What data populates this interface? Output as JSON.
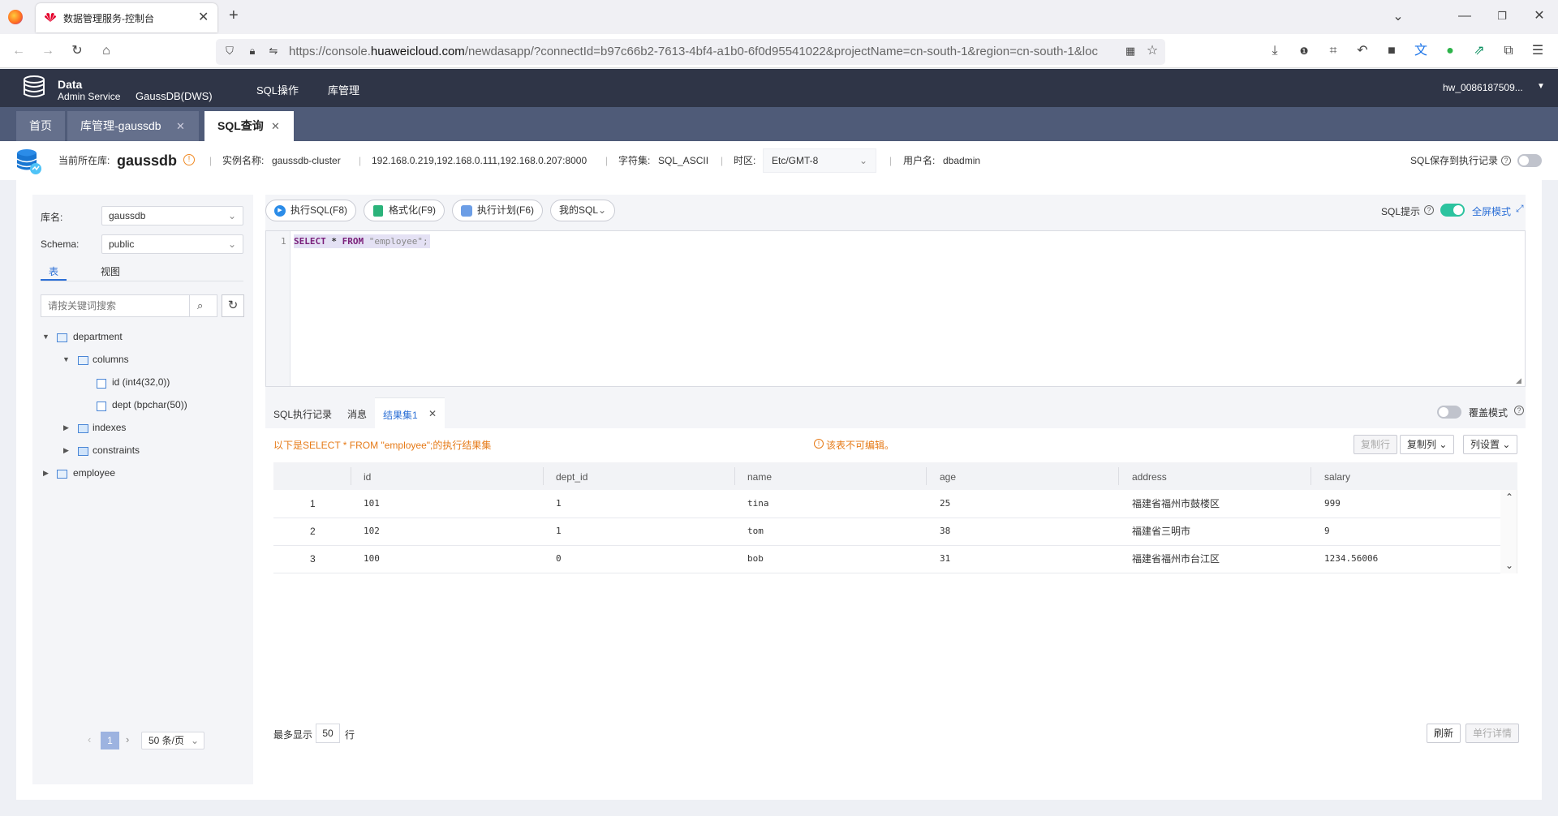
{
  "browser": {
    "tab_title": "数据管理服务-控制台",
    "url_prefix": "https://console.",
    "url_domain": "huaweicloud.com",
    "url_rest": "/newdasapp/?connectId=b97c66b2-7613-4bf4-a1b0-6f0d95541022&projectName=cn-south-1&region=cn-south-1&loc",
    "new_tab": "+"
  },
  "app": {
    "logo_line1": "Data",
    "logo_line2": "Admin Service",
    "db_type": "GaussDB(DWS)",
    "nav": [
      "SQL操作",
      "库管理"
    ],
    "user": "hw_0086187509..."
  },
  "tabs": [
    {
      "label": "首页"
    },
    {
      "label": "库管理-gaussdb"
    },
    {
      "label": "SQL查询"
    }
  ],
  "infobar": {
    "current_db_label": "当前所在库:",
    "current_db": "gaussdb",
    "instance_label": "实例名称:",
    "instance": "gaussdb-cluster",
    "ips": "192.168.0.219,192.168.0.111,192.168.0.207:8000",
    "charset_label": "字符集:",
    "charset": "SQL_ASCII",
    "timezone_label": "时区:",
    "timezone": "Etc/GMT-8",
    "user_label": "用户名:",
    "user": "dbadmin",
    "save_sql_label": "SQL保存到执行记录"
  },
  "left": {
    "db_label": "库名:",
    "db_value": "gaussdb",
    "schema_label": "Schema:",
    "schema_value": "public",
    "tab_tables": "表",
    "tab_views": "视图",
    "search_placeholder": "请按关键词搜索",
    "tree": {
      "department": "department",
      "columns": "columns",
      "col1": "id (int4(32,0))",
      "col2": "dept (bpchar(50))",
      "indexes": "indexes",
      "constraints": "constraints",
      "employee": "employee"
    },
    "page": "1",
    "page_size": "50 条/页"
  },
  "toolbar": {
    "run": "执行SQL(F8)",
    "format": "格式化(F9)",
    "plan": "执行计划(F6)",
    "my_sql": "我的SQL",
    "sql_hint": "SQL提示",
    "fullscreen": "全屏模式"
  },
  "editor": {
    "line_no": "1",
    "kw1": "SELECT",
    "star": " * ",
    "kw2": "FROM",
    "str": " \"employee\";"
  },
  "results": {
    "tabs": [
      "SQL执行记录",
      "消息",
      "结果集1"
    ],
    "overwrite_mode": "覆盖模式",
    "summary": "以下是SELECT * FROM \"employee\";的执行结果集",
    "readonly": "该表不可编辑。",
    "copy_row": "复制行",
    "copy_col": "复制列",
    "col_settings": "列设置",
    "columns": [
      "id",
      "dept_id",
      "name",
      "age",
      "address",
      "salary"
    ],
    "rows": [
      {
        "no": "1",
        "id": "101",
        "dept_id": "1",
        "name": "tina",
        "age": "25",
        "address": "福建省福州市鼓楼区",
        "salary": "999"
      },
      {
        "no": "2",
        "id": "102",
        "dept_id": "1",
        "name": "tom",
        "age": "38",
        "address": "福建省三明市",
        "salary": "9"
      },
      {
        "no": "3",
        "id": "100",
        "dept_id": "0",
        "name": "bob",
        "age": "31",
        "address": "福建省福州市台江区",
        "salary": "1234.56006"
      }
    ],
    "max_show_label": "最多显示",
    "max_show_value": "50",
    "max_show_unit": "行",
    "refresh": "刷新",
    "row_detail": "单行详情"
  }
}
